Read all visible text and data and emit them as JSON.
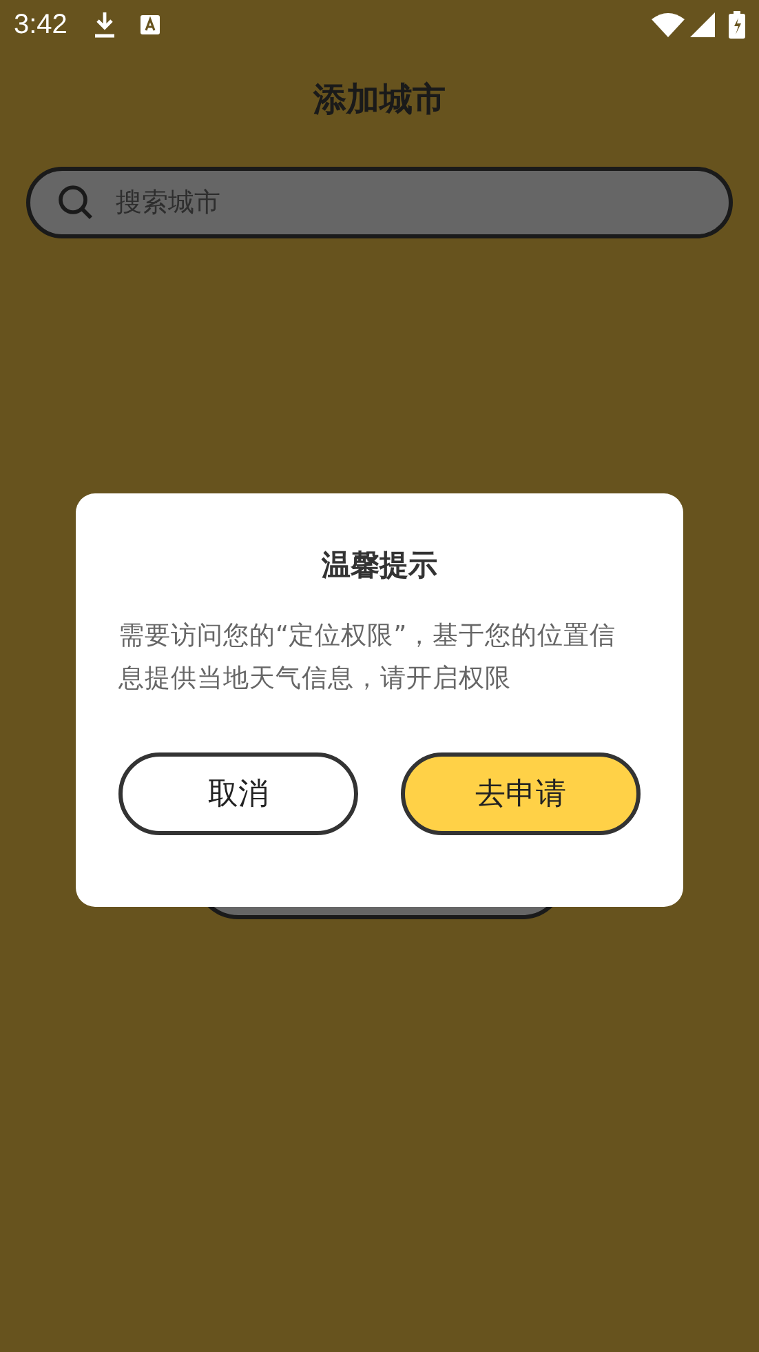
{
  "status_bar": {
    "time": "3:42"
  },
  "header": {
    "title": "添加城市"
  },
  "search": {
    "placeholder": "搜索城市"
  },
  "dialog": {
    "title": "温馨提示",
    "message": "需要访问您的“定位权限”，基于您的位置信息提供当地天气信息，请开启权限",
    "buttons": [
      {
        "label": "取消",
        "kind": "secondary"
      },
      {
        "label": "去申请",
        "kind": "primary"
      }
    ]
  }
}
